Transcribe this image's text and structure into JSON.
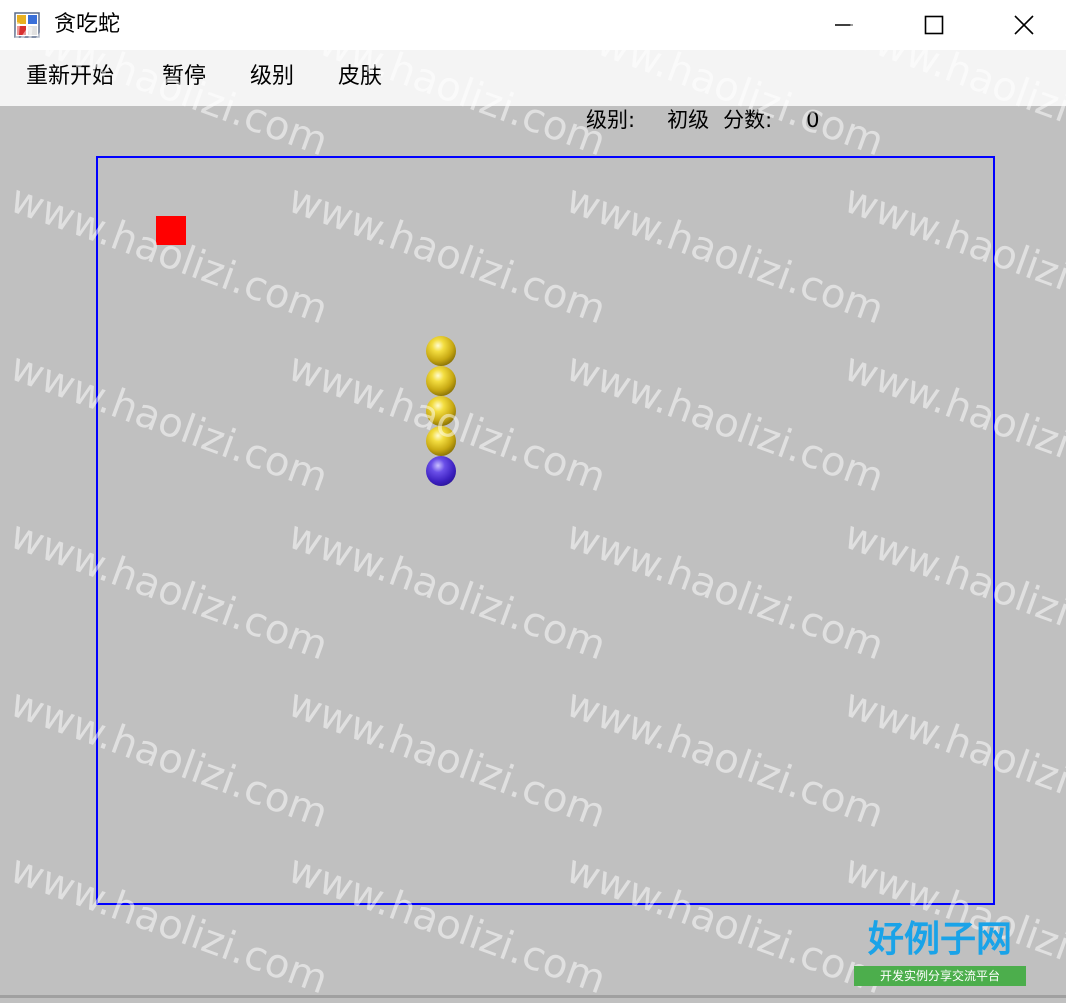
{
  "window": {
    "title": "贪吃蛇",
    "controls": [
      "minimize",
      "maximize",
      "close"
    ]
  },
  "menu": {
    "items": [
      {
        "label": "重新开始"
      },
      {
        "label": "暂停"
      },
      {
        "label": "级别"
      },
      {
        "label": "皮肤"
      }
    ]
  },
  "status": {
    "level_label": "级别:",
    "level_value": "初级",
    "score_label": "分数:",
    "score_value": "0"
  },
  "game": {
    "board_border_color": "#0000ff",
    "background_color": "#c0c0c0",
    "food_color": "#ff0000",
    "snake": {
      "body_color": "gold",
      "head_color": "purple",
      "length": 5
    }
  },
  "watermark": {
    "text": "www.haolizi.com"
  },
  "brand": {
    "title": "好例子网",
    "subtitle": "开发实例分享交流平台"
  }
}
